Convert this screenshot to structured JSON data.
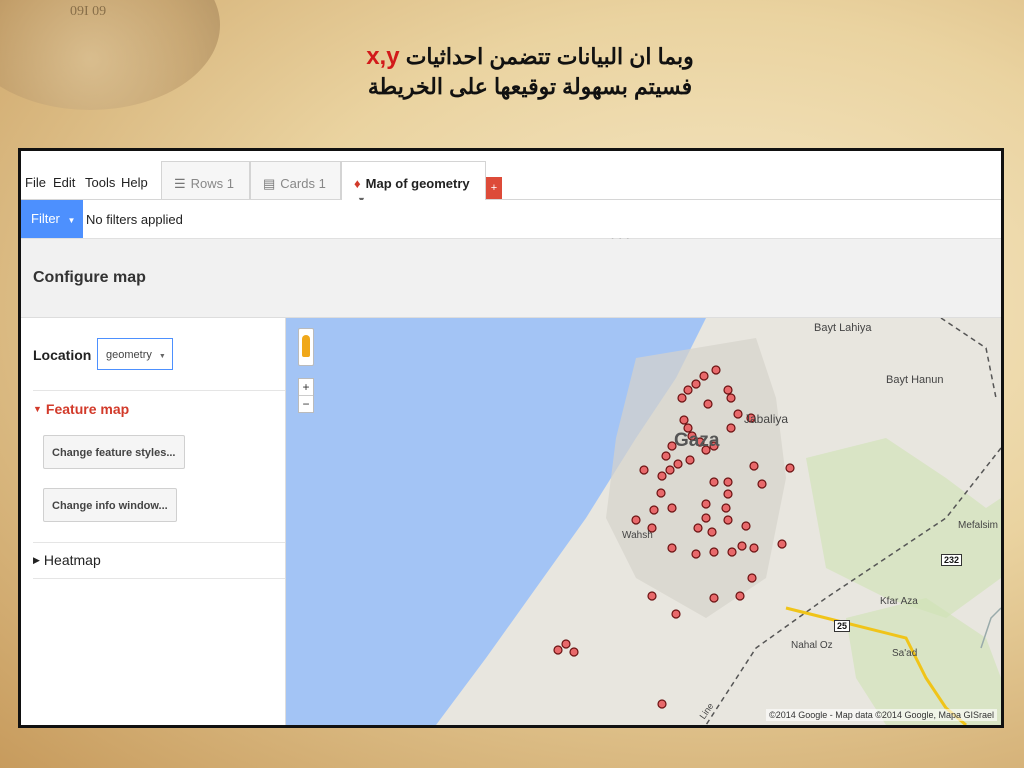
{
  "slide": {
    "title_line1_text": "وبما ان البيانات تتضمن احداثيات",
    "title_line1_highlight": "x,y",
    "title_line2": "فسيتم بسهولة توقيعها على الخريطة",
    "compass_text": "09I  09"
  },
  "app": {
    "menu": [
      "File",
      "Edit",
      "Tools",
      "Help"
    ],
    "tabs": [
      {
        "label": "Rows 1",
        "icon": "rows-icon"
      },
      {
        "label": "Cards 1",
        "icon": "cards-icon"
      },
      {
        "label": "Map of geometry",
        "icon": "map-pin-icon"
      }
    ],
    "add_tab": "+",
    "filter": {
      "button": "Filter",
      "status": "No filters applied"
    },
    "config_title": "Configure map",
    "sidebar": {
      "location_label": "Location",
      "location_value": "geometry",
      "feature_map": "Feature map",
      "change_styles": "Change feature styles...",
      "change_info": "Change info window...",
      "heatmap": "Heatmap"
    },
    "map": {
      "labels": [
        "Bayt Lahiya",
        "Bayt Hanun",
        "Jabaliya",
        "Gaza",
        "Wahsh",
        "Mefalsim",
        "Kfar Aza",
        "Nahal Oz",
        "Sa'ad",
        "Line"
      ],
      "road_numbers": [
        "232",
        "25"
      ],
      "zoom_in": "+",
      "zoom_out": "−",
      "copyright": "©2014 Google - Map data ©2014 Google, Mapa GISrael"
    }
  },
  "colors": {
    "accent": "#4d90fe",
    "feature": "#d23a2a",
    "sea": "#a3c4f5",
    "land": "#e8e6df"
  }
}
